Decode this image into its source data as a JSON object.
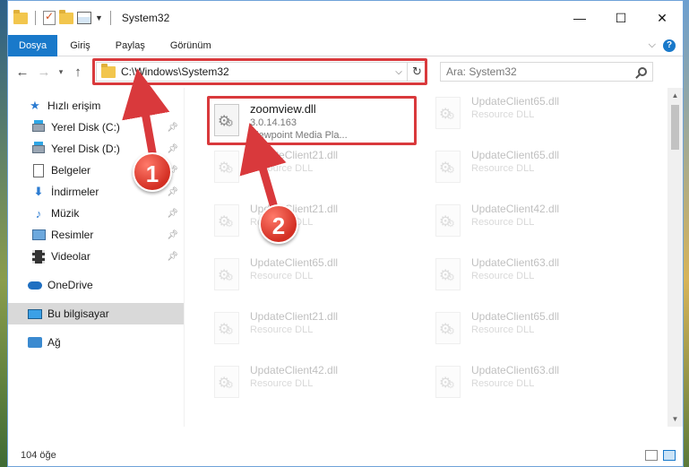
{
  "window": {
    "title": "System32",
    "controls": {
      "minimize": "—",
      "maximize": "☐",
      "close": "✕"
    }
  },
  "ribbon": {
    "tabs": [
      "Dosya",
      "Giriş",
      "Paylaş",
      "Görünüm"
    ],
    "help": "?"
  },
  "address": {
    "path": "C:\\Windows\\System32",
    "search_placeholder": "Ara: System32"
  },
  "sidebar": {
    "items": [
      {
        "label": "Hızlı erişim",
        "icon": "star-icon"
      },
      {
        "label": "Yerel Disk (C:)",
        "icon": "drive-icon",
        "pinned": true
      },
      {
        "label": "Yerel Disk (D:)",
        "icon": "drive-icon",
        "pinned": true
      },
      {
        "label": "Belgeler",
        "icon": "document-icon",
        "pinned": true
      },
      {
        "label": "İndirmeler",
        "icon": "download-icon",
        "pinned": true
      },
      {
        "label": "Müzik",
        "icon": "music-icon",
        "pinned": true
      },
      {
        "label": "Resimler",
        "icon": "pictures-icon",
        "pinned": true
      },
      {
        "label": "Videolar",
        "icon": "videos-icon",
        "pinned": true
      },
      {
        "label": "OneDrive",
        "icon": "cloud-icon"
      },
      {
        "label": "Bu bilgisayar",
        "icon": "computer-icon",
        "selected": true
      },
      {
        "label": "Ağ",
        "icon": "network-icon"
      }
    ]
  },
  "files": [
    {
      "name": "zoomview.dll",
      "line1": "3.0.14.163",
      "line2": "Viewpoint Media Pla...",
      "highlighted": true
    },
    {
      "name": "UpdateClient65.dll",
      "line1": "Resource DLL"
    },
    {
      "name": "UpdateClient21.dll",
      "line1": "Resource DLL"
    },
    {
      "name": "UpdateClient65.dll",
      "line1": "Resource DLL"
    },
    {
      "name": "UpdateClient21.dll",
      "line1": "Resource DLL"
    },
    {
      "name": "UpdateClient42.dll",
      "line1": "Resource DLL"
    },
    {
      "name": "UpdateClient65.dll",
      "line1": "Resource DLL"
    },
    {
      "name": "UpdateClient63.dll",
      "line1": "Resource DLL"
    },
    {
      "name": "UpdateClient21.dll",
      "line1": "Resource DLL"
    },
    {
      "name": "UpdateClient65.dll",
      "line1": "Resource DLL"
    },
    {
      "name": "UpdateClient42.dll",
      "line1": "Resource DLL"
    },
    {
      "name": "UpdateClient63.dll",
      "line1": "Resource DLL"
    }
  ],
  "status": {
    "count": "104 öğe"
  },
  "annotations": {
    "marker1": "1",
    "marker2": "2",
    "color": "#d9393c"
  }
}
